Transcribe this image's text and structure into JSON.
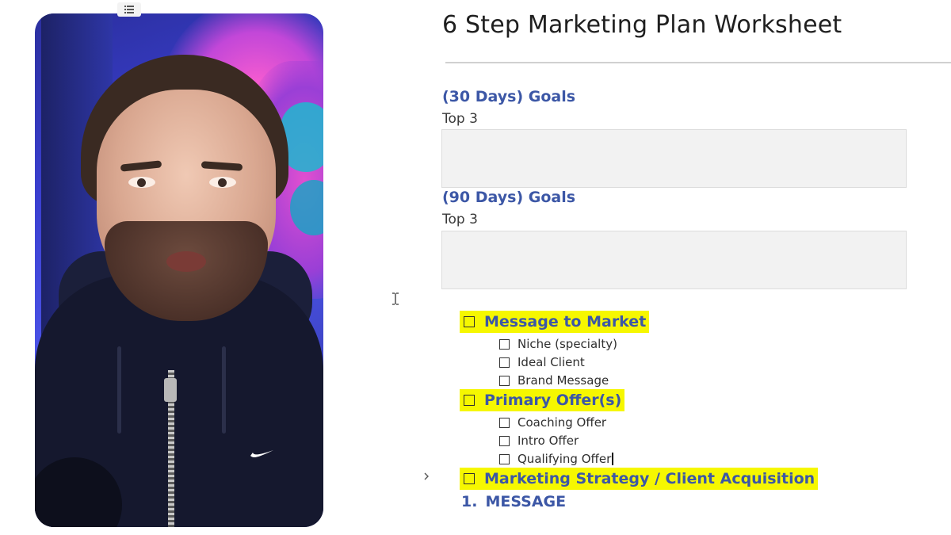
{
  "document": {
    "title": "6 Step Marketing Plan Worksheet",
    "goals": [
      {
        "heading": "(30 Days) Goals",
        "subheading": "Top 3"
      },
      {
        "heading": "(90 Days) Goals",
        "subheading": "Top 3"
      }
    ],
    "sections": [
      {
        "label": "Message to Market",
        "items": [
          "Niche (specialty)",
          "Ideal Client",
          "Brand Message"
        ]
      },
      {
        "label": "Primary Offer(s)",
        "items": [
          "Coaching Offer",
          "Intro Offer",
          "Qualifying Offer"
        ]
      },
      {
        "label": "Marketing Strategy / Client Acquisition",
        "items": []
      }
    ],
    "numbered_heading": {
      "number": "1.",
      "text": "MESSAGE"
    }
  },
  "colors": {
    "heading_blue": "#3c57a6",
    "highlight_yellow": "#f6f700",
    "goal_box_gray": "#f2f2f2"
  },
  "icons": {
    "page_menu": "list-icon",
    "text_cursor": "i-beam-cursor-icon",
    "collapse": "chevron-right-icon",
    "brand_logo": "swoosh-logo"
  }
}
